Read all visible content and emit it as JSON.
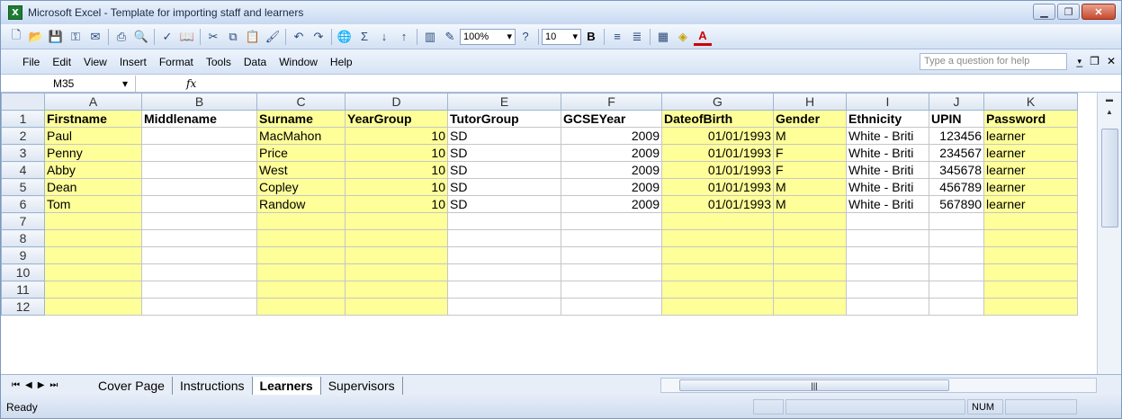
{
  "window": {
    "title": "Microsoft Excel - Template for importing staff and learners",
    "app_icon": "X"
  },
  "toolbar": {
    "zoom": "100%",
    "font_size": "10",
    "bold_label": "B",
    "font_color_label": "A"
  },
  "menu": {
    "items": [
      "File",
      "Edit",
      "View",
      "Insert",
      "Format",
      "Tools",
      "Data",
      "Window",
      "Help"
    ],
    "help_placeholder": "Type a question for help"
  },
  "formula_bar": {
    "cell_ref": "M35",
    "fx": "fx",
    "value": ""
  },
  "grid": {
    "columns": [
      "A",
      "B",
      "C",
      "D",
      "E",
      "F",
      "G",
      "H",
      "I",
      "J",
      "K"
    ],
    "header_row": [
      "Firstname",
      "Middlename",
      "Surname",
      "YearGroup",
      "TutorGroup",
      "GCSEYear",
      "DateofBirth",
      "Gender",
      "Ethnicity",
      "UPIN",
      "Password"
    ],
    "rows": [
      [
        "Paul",
        "",
        "MacMahon",
        "10",
        "SD",
        "2009",
        "01/01/1993",
        "M",
        "White - Briti",
        "123456",
        "learner"
      ],
      [
        "Penny",
        "",
        "Price",
        "10",
        "SD",
        "2009",
        "01/01/1993",
        "F",
        "White - Briti",
        "234567",
        "learner"
      ],
      [
        "Abby",
        "",
        "West",
        "10",
        "SD",
        "2009",
        "01/01/1993",
        "F",
        "White - Briti",
        "345678",
        "learner"
      ],
      [
        "Dean",
        "",
        "Copley",
        "10",
        "SD",
        "2009",
        "01/01/1993",
        "M",
        "White - Briti",
        "456789",
        "learner"
      ],
      [
        "Tom",
        "",
        "Randow",
        "10",
        "SD",
        "2009",
        "01/01/1993",
        "M",
        "White - Briti",
        "567890",
        "learner"
      ]
    ],
    "row_numbers": [
      "1",
      "2",
      "3",
      "4",
      "5",
      "6",
      "7",
      "8",
      "9",
      "10",
      "11",
      "12"
    ],
    "highlight_color": "#ffff99"
  },
  "sheet_tabs": [
    "Cover Page",
    "Instructions",
    "Learners",
    "Supervisors"
  ],
  "active_sheet": "Learners",
  "status": {
    "text": "Ready",
    "num": "NUM"
  }
}
